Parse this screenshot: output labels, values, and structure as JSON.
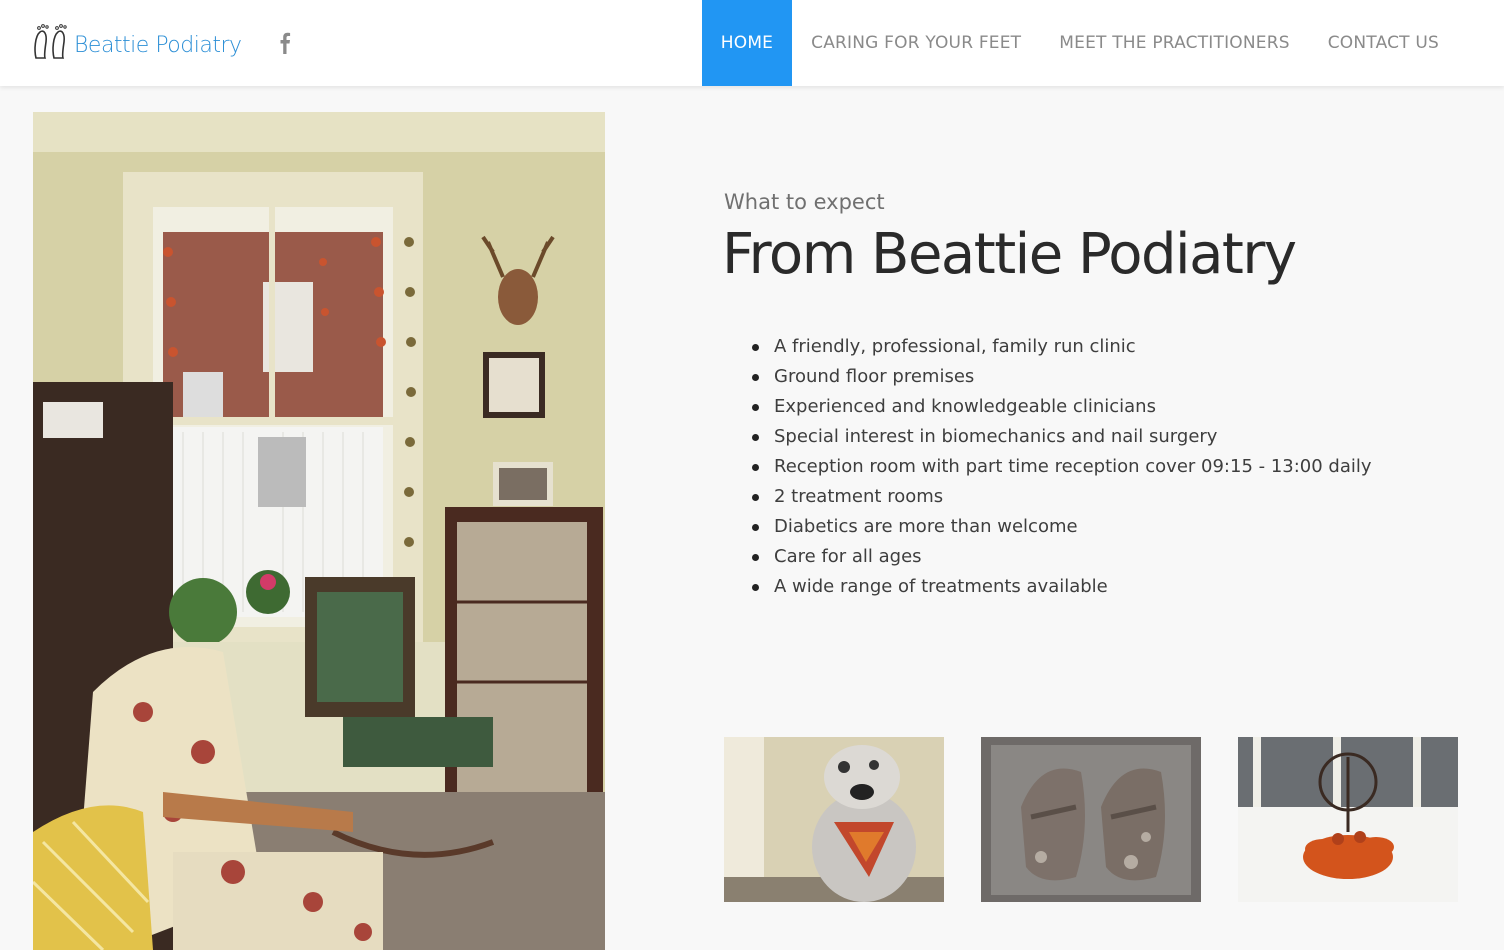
{
  "brand": {
    "name": "Beattie Podiatry",
    "accent_color": "#2196f3",
    "logo_text_color": "#2c8fd6"
  },
  "header": {
    "social_icon": "facebook-icon",
    "nav": [
      {
        "label": "HOME",
        "active": true
      },
      {
        "label": "CARING FOR YOUR FEET",
        "active": false
      },
      {
        "label": "MEET THE PRACTITIONERS",
        "active": false
      },
      {
        "label": "CONTACT US",
        "active": false
      }
    ]
  },
  "main": {
    "kicker": "What to expect",
    "title": "From Beattie Podiatry",
    "features": [
      "A friendly, professional, family run clinic",
      "Ground floor premises",
      "Experienced and knowledgeable clinicians",
      "Special interest in biomechanics and nail surgery",
      "Reception room with part time reception cover 09:15 - 13:00 daily",
      "2 treatment rooms",
      "Diabetics are more than welcome",
      "Care for all ages",
      "A wide range of treatments available"
    ]
  }
}
